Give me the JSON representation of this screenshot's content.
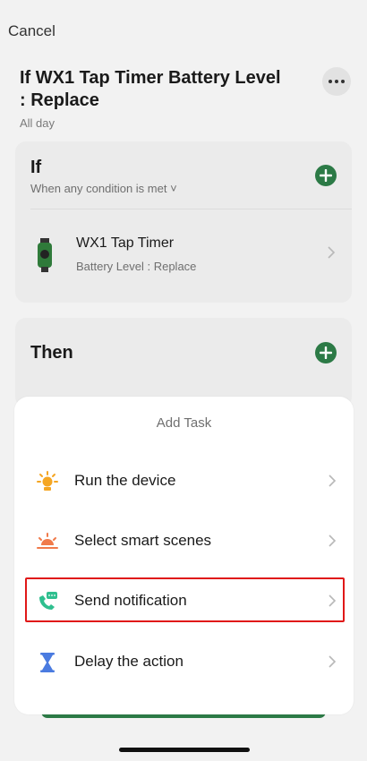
{
  "header": {
    "cancel_label": "Cancel",
    "title": "If WX1 Tap Timer Battery Level : Replace",
    "subtitle": "All day",
    "more_icon": "more-icon"
  },
  "if_section": {
    "heading": "If",
    "condition_mode": "When any condition is met ˅",
    "device": {
      "name": "WX1 Tap Timer",
      "state": "Battery Level : Replace"
    }
  },
  "then_section": {
    "heading": "Then"
  },
  "add_task_sheet": {
    "title": "Add Task",
    "items": [
      {
        "label": "Run the device",
        "icon": "sun-icon",
        "color": "#f5a623"
      },
      {
        "label": "Select smart scenes",
        "icon": "sunset-icon",
        "color": "#f07a4a"
      },
      {
        "label": "Send notification",
        "icon": "phone-message-icon",
        "color": "#2fbf8f"
      },
      {
        "label": "Delay the action",
        "icon": "hourglass-icon",
        "color": "#4a7be0"
      }
    ]
  },
  "colors": {
    "accent_green": "#2c7a46",
    "highlight_red": "#e01818"
  }
}
